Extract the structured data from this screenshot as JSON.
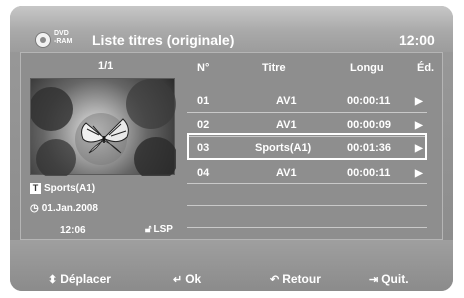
{
  "window": {
    "disc_type_line1": "DVD",
    "disc_type_line2": "-RAM",
    "title": "Liste titres (originale)",
    "time": "12:00"
  },
  "left_panel": {
    "page_indicator": "1/1",
    "selected_title": "Sports(A1)",
    "date": "01.Jan.2008",
    "recorded_time": "12:06",
    "mode": "LSP"
  },
  "table": {
    "columns": [
      "N°",
      "Titre",
      "Longu",
      "Éd."
    ],
    "rows": [
      {
        "no": "01",
        "title": "AV1",
        "length": "00:00:11",
        "edit": "▶"
      },
      {
        "no": "02",
        "title": "AV1",
        "length": "00:00:09",
        "edit": "▶"
      },
      {
        "no": "03",
        "title": "Sports(A1)",
        "length": "00:01:36",
        "edit": "▶"
      },
      {
        "no": "04",
        "title": "AV1",
        "length": "00:00:11",
        "edit": "▶"
      }
    ],
    "selected_row": "03"
  },
  "footer": {
    "move_label": "Déplacer",
    "ok_label": "Ok",
    "back_label": "Retour",
    "quit_label": "Quit."
  }
}
